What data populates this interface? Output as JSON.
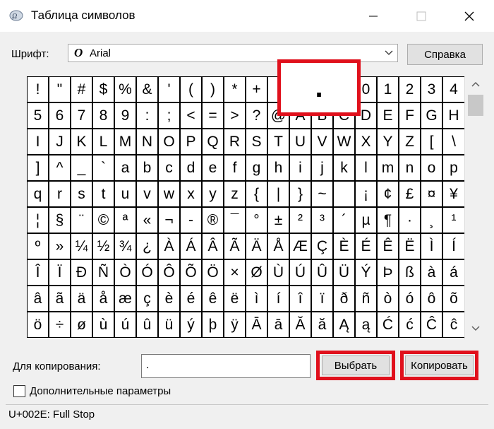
{
  "window": {
    "title": "Таблица символов",
    "icon": "charmap-app-icon",
    "controls": [
      "minimize-icon",
      "maximize-icon",
      "close-icon"
    ]
  },
  "font": {
    "label": "Шрифт:",
    "selected": "Arial",
    "icon_glyph": "O"
  },
  "help_button": "Справка",
  "grid": {
    "rows": [
      [
        "!",
        "\"",
        "#",
        "$",
        "%",
        "&",
        "'",
        "(",
        ")",
        "*",
        "+",
        ",",
        "-",
        ".",
        "/",
        "0",
        "1",
        "2",
        "3",
        "4"
      ],
      [
        "5",
        "6",
        "7",
        "8",
        "9",
        ":",
        ";",
        "<",
        "=",
        ">",
        "?",
        "@",
        "A",
        "B",
        "C",
        "D",
        "E",
        "F",
        "G",
        "H"
      ],
      [
        "I",
        "J",
        "K",
        "L",
        "M",
        "N",
        "O",
        "P",
        "Q",
        "R",
        "S",
        "T",
        "U",
        "V",
        "W",
        "X",
        "Y",
        "Z",
        "[",
        "\\"
      ],
      [
        "]",
        "^",
        "_",
        "`",
        "a",
        "b",
        "c",
        "d",
        "e",
        "f",
        "g",
        "h",
        "i",
        "j",
        "k",
        "l",
        "m",
        "n",
        "o",
        "p"
      ],
      [
        "q",
        "r",
        "s",
        "t",
        "u",
        "v",
        "w",
        "x",
        "y",
        "z",
        "{",
        "|",
        "}",
        "~",
        " ",
        "¡",
        "¢",
        "£",
        "¤",
        "¥"
      ],
      [
        "¦",
        "§",
        "¨",
        "©",
        "ª",
        "«",
        "¬",
        "-",
        "®",
        "¯",
        "°",
        "±",
        "²",
        "³",
        "´",
        "µ",
        "¶",
        "·",
        "¸",
        "¹"
      ],
      [
        "º",
        "»",
        "¼",
        "½",
        "¾",
        "¿",
        "À",
        "Á",
        "Â",
        "Ã",
        "Ä",
        "Å",
        "Æ",
        "Ç",
        "È",
        "É",
        "Ê",
        "Ë",
        "Ì",
        "Í"
      ],
      [
        "Î",
        "Ï",
        "Ð",
        "Ñ",
        "Ò",
        "Ó",
        "Ô",
        "Õ",
        "Ö",
        "×",
        "Ø",
        "Ù",
        "Ú",
        "Û",
        "Ü",
        "Ý",
        "Þ",
        "ß",
        "à",
        "á"
      ],
      [
        "â",
        "ã",
        "ä",
        "å",
        "æ",
        "ç",
        "è",
        "é",
        "ê",
        "ë",
        "ì",
        "í",
        "î",
        "ï",
        "ð",
        "ñ",
        "ò",
        "ó",
        "ô",
        "õ"
      ],
      [
        "ö",
        "÷",
        "ø",
        "ù",
        "ú",
        "û",
        "ü",
        "ý",
        "þ",
        "ÿ",
        "Ā",
        "ā",
        "Ă",
        "ă",
        "Ą",
        "ą",
        "Ć",
        "ć",
        "Ĉ",
        "ĉ"
      ]
    ],
    "selected_char": "."
  },
  "copy": {
    "label": "Для копирования:",
    "value": ".",
    "select_button": "Выбрать",
    "copy_button": "Копировать"
  },
  "advanced": {
    "label": "Дополнительные параметры",
    "checked": false
  },
  "status": "U+002E: Full Stop",
  "colors": {
    "highlight": "#e0101c",
    "background": "#f0f0f0"
  }
}
